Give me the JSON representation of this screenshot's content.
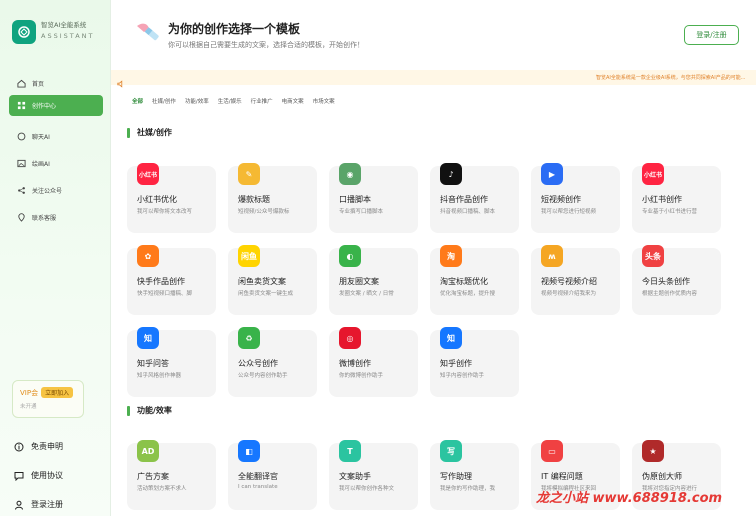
{
  "app": {
    "name": "智览AI全能系统",
    "tagline": "ASSISTANT"
  },
  "sidebar": {
    "items": [
      {
        "label": "首页",
        "icon": "home-icon"
      },
      {
        "label": "创作中心",
        "icon": "grid-icon",
        "active": true
      },
      {
        "label": "聊天AI",
        "icon": "chat-icon"
      },
      {
        "label": "绘画AI",
        "icon": "image-icon"
      },
      {
        "label": "关注公众号",
        "icon": "share-icon"
      },
      {
        "label": "联系客服",
        "icon": "location-icon"
      }
    ],
    "vip": {
      "label": "VIP会",
      "button": "立即加入",
      "sub": "未开通"
    },
    "bottom": [
      {
        "label": "免责申明",
        "icon": "info-icon"
      },
      {
        "label": "使用协议",
        "icon": "message-icon"
      },
      {
        "label": "登录注册",
        "icon": "user-icon"
      }
    ]
  },
  "header": {
    "title": "为你的创作选择一个模板",
    "subtitle": "你可以根据自己需要生成的文案，选择合适的模板，开始创作！",
    "login": "登录/注册"
  },
  "notice": {
    "text": "智览AI全能系统是一款企业级AI系统，与您共同探索AI产品的可能..."
  },
  "tabs": [
    "全部",
    "社媒/创作",
    "功能/效率",
    "生活/娱乐",
    "行业推广",
    "电商文案",
    "市场文案"
  ],
  "sections": [
    {
      "title": "社媒/创作",
      "cards": [
        {
          "title": "小红书优化",
          "desc": "我可以帮你将文本改写",
          "icon": "xiaohongshu-icon",
          "glyph": "小红书",
          "color": "#ff2442"
        },
        {
          "title": "爆款标题",
          "desc": "短视频/公众号爆款标",
          "icon": "pencil-icon",
          "glyph": "✎",
          "color": "#f5b933"
        },
        {
          "title": "口播脚本",
          "desc": "专业撰写口播脚本",
          "icon": "film-icon",
          "glyph": "◉",
          "color": "#5aa469"
        },
        {
          "title": "抖音作品创作",
          "desc": "抖音视频口播稿、脚本",
          "icon": "douyin-icon",
          "glyph": "♪",
          "color": "#111111"
        },
        {
          "title": "短视频创作",
          "desc": "我可以帮您进行短视频",
          "icon": "play-icon",
          "glyph": "▶",
          "color": "#2a6cf4"
        },
        {
          "title": "小红书创作",
          "desc": "专业基于小红书进行营",
          "icon": "xiaohongshu-icon",
          "glyph": "小红书",
          "color": "#ff2442"
        },
        {
          "title": "快手作品创作",
          "desc": "快手短视频口播稿、脚",
          "icon": "kuaishou-icon",
          "glyph": "✿",
          "color": "#ff7a1a"
        },
        {
          "title": "闲鱼卖货文案",
          "desc": "闲鱼卖货文案一键生成",
          "icon": "xianyu-icon",
          "glyph": "闲鱼",
          "color": "#ffd400"
        },
        {
          "title": "朋友圈文案",
          "desc": "发圈文案 / 晒文 / 日常",
          "icon": "moments-icon",
          "glyph": "◐",
          "color": "#39b34a"
        },
        {
          "title": "淘宝标题优化",
          "desc": "优化淘宝标题，提升搜",
          "icon": "taobao-icon",
          "glyph": "淘",
          "color": "#ff7a1a"
        },
        {
          "title": "视频号视频介绍",
          "desc": "视频号视频介绍我来为",
          "icon": "channels-icon",
          "glyph": "ʍ",
          "color": "#f5a623"
        },
        {
          "title": "今日头条创作",
          "desc": "根据主题创作优质内容",
          "icon": "toutiao-icon",
          "glyph": "头条",
          "color": "#f04142"
        },
        {
          "title": "知乎问答",
          "desc": "知乎风格创作神器",
          "icon": "zhihu-icon",
          "glyph": "知",
          "color": "#1677ff"
        },
        {
          "title": "公众号创作",
          "desc": "公众号内容创作助手",
          "icon": "recycle-icon",
          "glyph": "♻",
          "color": "#39b34a"
        },
        {
          "title": "微博创作",
          "desc": "你的微博创作助手",
          "icon": "weibo-icon",
          "glyph": "◎",
          "color": "#e6162d"
        },
        {
          "title": "知乎创作",
          "desc": "知乎内容创作助手",
          "icon": "zhihu-icon",
          "glyph": "知",
          "color": "#1677ff"
        }
      ]
    },
    {
      "title": "功能/效率",
      "cards": [
        {
          "title": "广告方案",
          "desc": "活动策划方案不求人",
          "icon": "ad-icon",
          "glyph": "AD",
          "color": "#8bc34a"
        },
        {
          "title": "全能翻译官",
          "desc": "I can translate",
          "icon": "translate-icon",
          "glyph": "◧",
          "color": "#1677ff"
        },
        {
          "title": "文案助手",
          "desc": "我可以帮你创作各种文",
          "icon": "text-icon",
          "glyph": "T",
          "color": "#2bc4a0"
        },
        {
          "title": "写作助理",
          "desc": "我是你的写作助理，我",
          "icon": "write-icon",
          "glyph": "写",
          "color": "#2bc4a0"
        },
        {
          "title": "IT 编程问题",
          "desc": "我将模拟编程社区来回",
          "icon": "code-icon",
          "glyph": "▭",
          "color": "#f04142"
        },
        {
          "title": "伪原创大师",
          "desc": "我将对您指定内容进行",
          "icon": "seal-icon",
          "glyph": "★",
          "color": "#b02a2a"
        }
      ]
    }
  ],
  "watermark": "龙之小站 www.688918.com",
  "colors": {
    "accent": "#4caf50",
    "notice": "#e0822a"
  }
}
